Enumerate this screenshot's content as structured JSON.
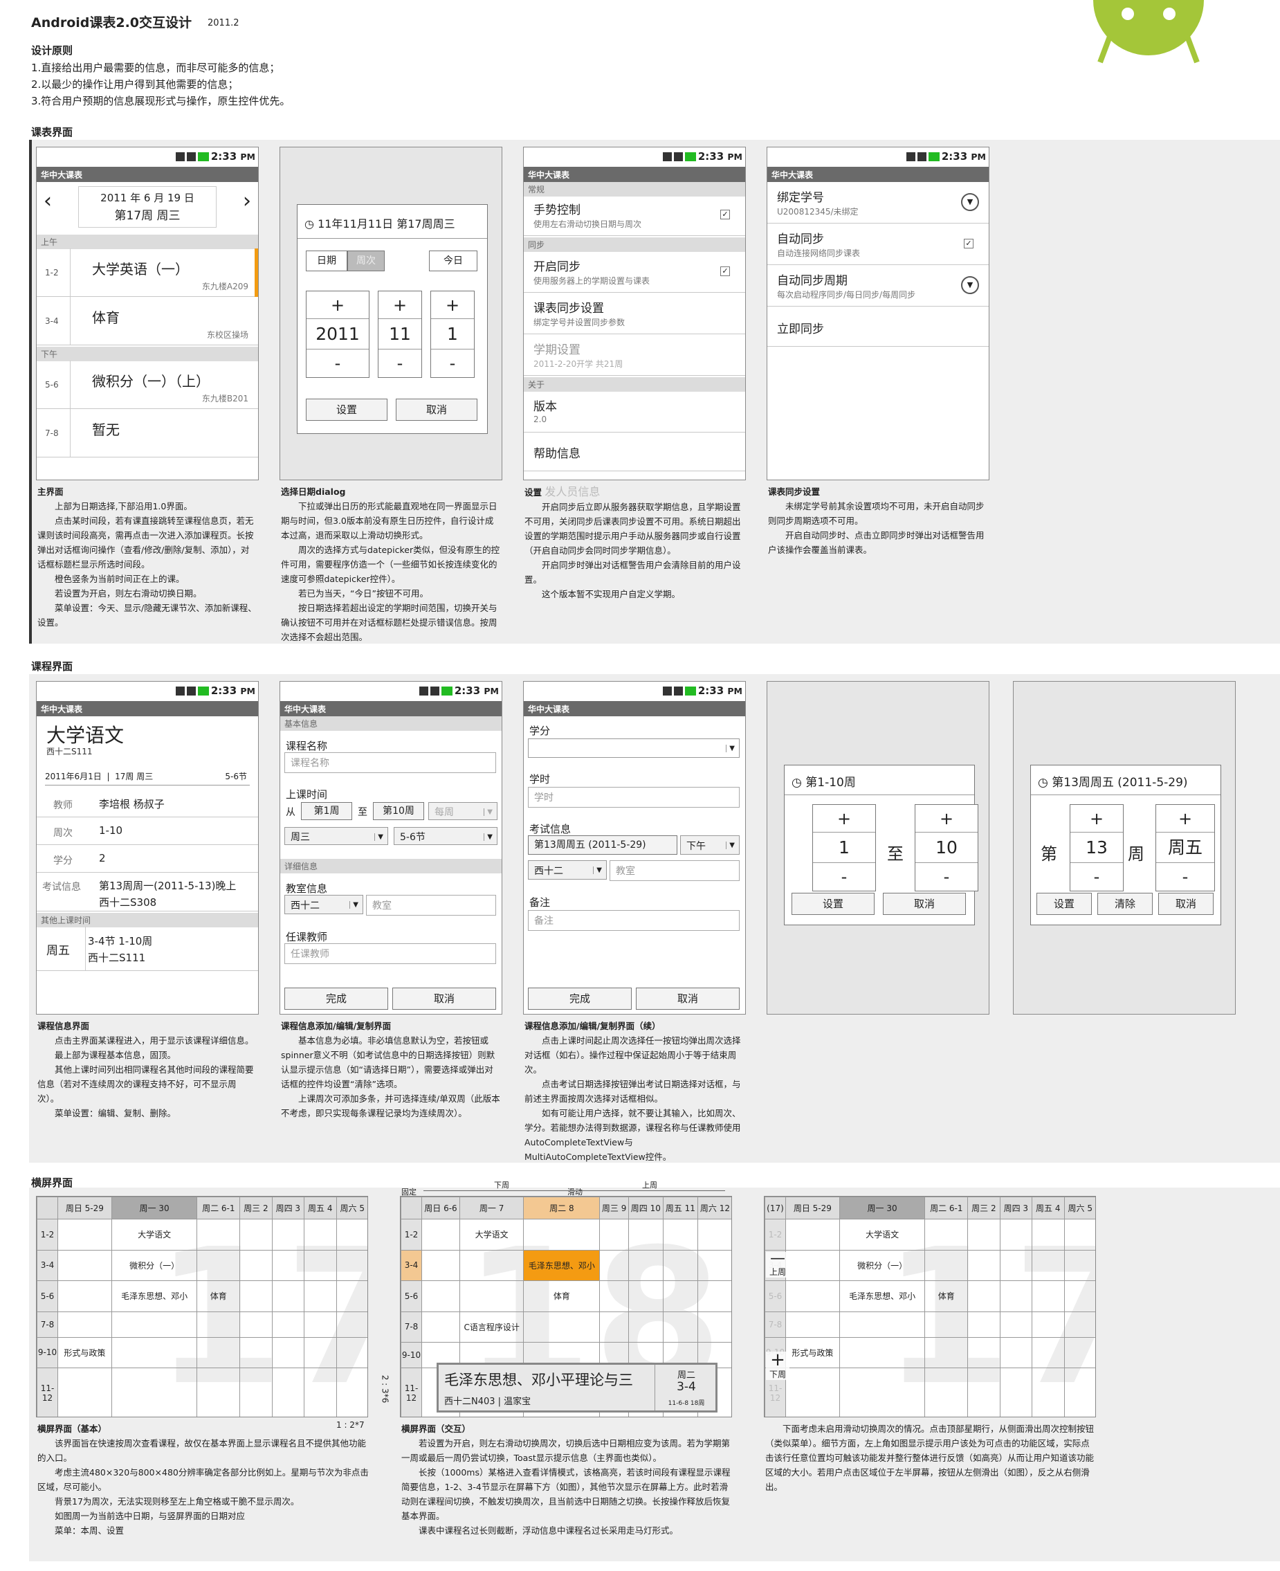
{
  "doc": {
    "title": "Android课表2.0交互设计",
    "date": "2011.2",
    "principles_title": "设计原则",
    "principles": [
      "1.直接给出用户最需要的信息，而非尽可能多的信息；",
      "2.以最少的操作让用户得到其他需要的信息；",
      "3.符合用户预期的信息展现形式与操作，原生控件优先。"
    ],
    "sec1": "课表界面",
    "sec2": "课程界面",
    "sec3": "横屏界面"
  },
  "status": {
    "time": "2:33",
    "ampm": "PM"
  },
  "app_title": "华中大课表",
  "main": {
    "date": "2011 年 6 月 19 日",
    "week": "第17周 周三",
    "am": "上午",
    "pm": "下午",
    "rows": [
      {
        "slot": "1-2",
        "course": "大学英语（一）",
        "room": "东九楼A209"
      },
      {
        "slot": "3-4",
        "course": "体育",
        "room": "东校区操场"
      },
      {
        "slot": "5-6",
        "course": "微积分（一）（上）",
        "room": "东九楼B201"
      },
      {
        "slot": "7-8",
        "course": "暂无",
        "room": ""
      }
    ]
  },
  "datedlg": {
    "title": "11年11月11日  第17周周三",
    "tab_day": "日期",
    "tab_week": "周次",
    "today": "今日",
    "values": [
      "2011",
      "11",
      "1"
    ],
    "ok": "设置",
    "cancel": "取消"
  },
  "settings": {
    "general": "常规",
    "gesture": "手势控制",
    "gesture_sub": "使用左右滑动切换日期与周次",
    "sync": "同步",
    "open_sync": "开启同步",
    "open_sync_sub": "使用服务器上的学期设置与课表",
    "course_sync": "课表同步设置",
    "course_sync_sub": "绑定学号并设置同步参数",
    "term": "学期设置",
    "term_sub": "2011-2-20开学 共21周",
    "about": "关于",
    "version": "版本",
    "version_val": "2.0",
    "help": "帮助信息"
  },
  "syncset": {
    "bind": "绑定学号",
    "bind_sub": "U200812345/未绑定",
    "auto": "自动同步",
    "auto_sub": "自动连接网络同步课表",
    "period": "自动同步周期",
    "period_sub": "每次启动程序同步/每日同步/每周同步",
    "now": "立即同步"
  },
  "cap1": {
    "t1": "主界面",
    "p1": [
      "上部为日期选择,下部沿用1.0界面。",
      "点击某时间段，若有课直接跳转至课程信息页，若无课则该时间段高亮，需再点击一次进入添加课程页。长按弹出对话框询问操作（查看/修改/删除/复制、添加），对话框标题栏显示所选时间段。",
      "橙色竖条为当前时间正在上的课。",
      "若设置为开启，则左右滑动切换日期。",
      "菜单设置：今天、显示/隐藏无课节次、添加新课程、设置。"
    ],
    "t2": "选择日期dialog",
    "p2": [
      "下拉或弹出日历的形式能最直观地在同一界面显示日期与时间，但3.0版本前没有原生日历控件，自行设计成本过高，退而采取以上滑动切换形式。",
      "周次的选择方式与datepicker类似，但没有原生的控件可用，需要程序仿造一个（一些细节如长按连续变化的速度可参照datepicker控件）。",
      "若已为当天，“今日”按钮不可用。",
      "按日期选择若超出设定的学期时间范围，切换开关与确认按钮不可用并在对话框标题栏处提示错误信息。按周次选择不会超出范围。"
    ],
    "t3": "设置",
    "t3b": "发人员信息",
    "p3": [
      "开启同步后立即从服务器获取学期信息，且学期设置不可用，关闭同步后课表同步设置不可用。系统日期超出设置的学期范围时提示用户手动从服务器同步或自行设置（开启自动同步会同时同步学期信息）。",
      "开启同步时弹出对话框警告用户会清除目前的用户设置。",
      "这个版本暂不实现用户自定义学期。"
    ],
    "t4": "课表同步设置",
    "p4": [
      "未绑定学号前其余设置项均不可用，未开启自动同步则同步周期选项不可用。",
      "开启自动同步时、点击立即同步时弹出对话框警告用户该操作会覆盖当前课表。"
    ]
  },
  "detail": {
    "name": "大学语文",
    "room": "西十二S111",
    "date": "2011年6月1日",
    "week": "17周 周三",
    "slot": "5-6节",
    "teacher_l": "教师",
    "teacher": "李培根 杨叔子",
    "weeks_l": "周次",
    "weeks": "1-10",
    "credit_l": "学分",
    "credit": "2",
    "exam_l": "考试信息",
    "exam": "第13周周一(2011-5-13)晚上",
    "exam2": "西十二S308",
    "other": "其他上课时间",
    "o_day": "周五",
    "o_time": "3-4节 1-10周",
    "o_room": "西十二S111"
  },
  "edit": {
    "basic": "基本信息",
    "cname": "课程名称",
    "cname_ph": "课程名称",
    "time": "上课时间",
    "from": "从",
    "w1": "第1周",
    "to": "至",
    "w2": "第10周",
    "every": "每周",
    "day": "周三",
    "slot": "5-6节",
    "more": "详细信息",
    "room_l": "教室信息",
    "bld": "西十二",
    "room_ph": "教室",
    "teacher_l": "任课教师",
    "teacher_ph": "任课教师",
    "done": "完成",
    "cancel": "取消"
  },
  "edit2": {
    "credit": "学分",
    "hours": "学时",
    "hours_ph": "学时",
    "exam": "考试信息",
    "exam_d": "第13周周五 (2011-5-29)",
    "pm": "下午",
    "bld": "西十二",
    "room_ph": "教室",
    "note": "备注",
    "note_ph": "备注",
    "done": "完成",
    "cancel": "取消"
  },
  "wdlg": {
    "title": "第1-10周",
    "a": "1",
    "to": "至",
    "b": "10",
    "ok": "设置",
    "cancel": "取消"
  },
  "edlg": {
    "title": "第13周周五 (2011-5-29)",
    "di": "第",
    "n": "13",
    "zhou": "周",
    "day": "周五",
    "ok": "设置",
    "clear": "清除",
    "cancel": "取消"
  },
  "cap2": {
    "t1": "课程信息界面",
    "p1": [
      "点击主界面某课程进入，用于显示该课程详细信息。",
      "最上部为课程基本信息，固顶。",
      "其他上课时间列出相同课程名其他时间段的课程简要信息（若对不连续周次的课程支持不好，可不显示周次）。",
      "菜单设置：编辑、复制、删除。"
    ],
    "t2": "课程信息添加/编辑/复制界面",
    "p2": [
      "基本信息为必填。非必填信息默认为空，若按钮或spinner意义不明（如考试信息中的日期选择按钮）则默认显示提示信息（如“请选择日期”），需要选择或弹出对话框的控件均设置“清除”选项。",
      "上课周次可添加多条，并可选择连续/单双周（此版本不考虑，即只实现每条课程记录均为连续周次）。"
    ],
    "t3": "课程信息添加/编辑/复制界面（续）",
    "p3": [
      "点击上课时间起止周次选择任一按钮均弹出周次选择对话框（如右）。操作过程中保证起始周小于等于结束周次。",
      "点击考试日期选择按钮弹出考试日期选择对话框，与前述主界面按周次选择对话框相似。",
      "如有可能让用户选择，就不要让其输入，比如周次、学分。若能想办法得到数据源，课程名称与任课教师使用AutoCompleteTextView与MultiAutoCompleteTextView控件。"
    ]
  },
  "land": {
    "days": [
      "周日 5-29",
      "周一 30",
      "周二 6-1",
      "周三 2",
      "周四 3",
      "周五 4",
      "周六 5"
    ],
    "slots": [
      "1-2",
      "3-4",
      "5-6",
      "7-8",
      "9-10",
      "11-12"
    ],
    "big1": "17",
    "big2": "18",
    "c_yw": "大学语文",
    "c_wjf": "微积分（一）",
    "c_mzd": "毛泽东思想、邓小",
    "c_ty": "体育",
    "c_xs": "形式与政策",
    "c_c": "C语言程序设计",
    "days2": [
      "周日 6-6",
      "周一 7",
      "周二 8",
      "周三 9",
      "周四 10",
      "周五 11",
      "周六 12"
    ],
    "fixed": "固定",
    "prevw": "下周",
    "slide": "滑动",
    "nextw": "上周",
    "c_mzd2": "毛泽东思想、邓小",
    "pop_name": "毛泽东思想、邓小平理论与三",
    "pop_room": "西十二N403 | 温家宝",
    "pop_day": "周二",
    "pop_slot": "3-4",
    "pop_w": "11-6-8 18周",
    "ratio1": "1 : 2*7",
    "ratio2": "2 : 3*6",
    "prev_up": "上周",
    "next_dn": "下周",
    "wk17": "(17)"
  },
  "cap3": {
    "t1": "横屏界面（基本）",
    "p1": [
      "该界面旨在快速按周次查看课程，故仅在基本界面上显示课程名且不提供其他功能的入口。",
      "考虑主流480×320与800×480分辨率确定各部分比例如上。星期与节次为非点击区域，尽可能小。",
      "背景17为周次，无法实现则移至左上角空格或干脆不显示周次。",
      "如图周一为当前选中日期，与竖屏界面的日期对应",
      "菜单：本周、设置"
    ],
    "t2": "横屏界面（交互）",
    "p2": [
      "若设置为开启，则左右滑动切换周次，切换后选中日期相应变为该周。若为学期第一周或最后一周仍尝试切换，Toast显示提示信息（主界面也类似）。",
      "长按（1000ms）某格进入查看详情模式，该格高亮，若该时间段有课程显示课程简要信息，1-2、3-4节显示在屏幕下方（如图），其他节次显示在屏幕上方。此时若滑动则在课程间切换，不触发切换周次，且当前选中日期随之切换。长按操作释放后恢复基本界面。",
      "课表中课程名过长则截断，浮动信息中课程名过长采用走马灯形式。"
    ],
    "p3": [
      "下面考虑未启用滑动切换周次的情况。点击顶部星期行，从侧面滑出周次控制按钮（类似菜单）。细节方面，左上角如图显示提示用户该处为可点击的功能区域，实际点击该行任意位置均可触该功能发并整行整体进行反馈（如高亮）从而让用户知道该功能区域的大小。若用户点击区域位于左半屏幕，按钮从左侧滑出（如图），反之从右侧滑出。"
    ]
  }
}
